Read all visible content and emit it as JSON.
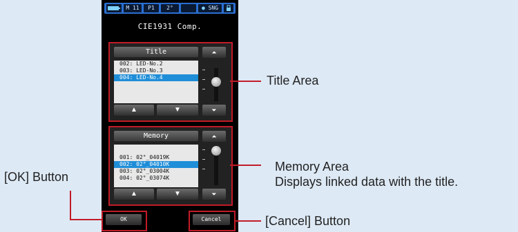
{
  "status_bar": {
    "mode": "M 11",
    "preset": "P1",
    "angle": "2°",
    "measure_mode": "SNG"
  },
  "screen": {
    "title": "CIE1931 Comp."
  },
  "title_panel": {
    "header": "Title",
    "items": [
      "002: LED-No.2",
      "003: LED-No.3",
      "004: LED-No.4"
    ],
    "selected_index": 2
  },
  "memory_panel": {
    "header": "Memory",
    "items": [
      "001: 02°_04019K",
      "002: 02°_04010K",
      "003: 02°_03004K",
      "004: 02°_03074K"
    ],
    "selected_index": 1
  },
  "buttons": {
    "ok": "OK",
    "cancel": "Cancel"
  },
  "annotations": {
    "title_area": "Title Area",
    "memory_area": "Memory Area",
    "memory_desc": "Displays linked data with the title.",
    "ok_button": "[OK] Button",
    "cancel_button": "[Cancel] Button"
  },
  "icons": {
    "scroll_top": "double-up-arrow-icon",
    "scroll_bottom": "double-down-arrow-icon",
    "up": "up-triangle-icon",
    "down": "down-triangle-icon"
  },
  "colors": {
    "highlight": "#1f8ed8",
    "callout": "#c21b28",
    "status_bar": "#2b6fd1",
    "background": "#dde9f5"
  }
}
